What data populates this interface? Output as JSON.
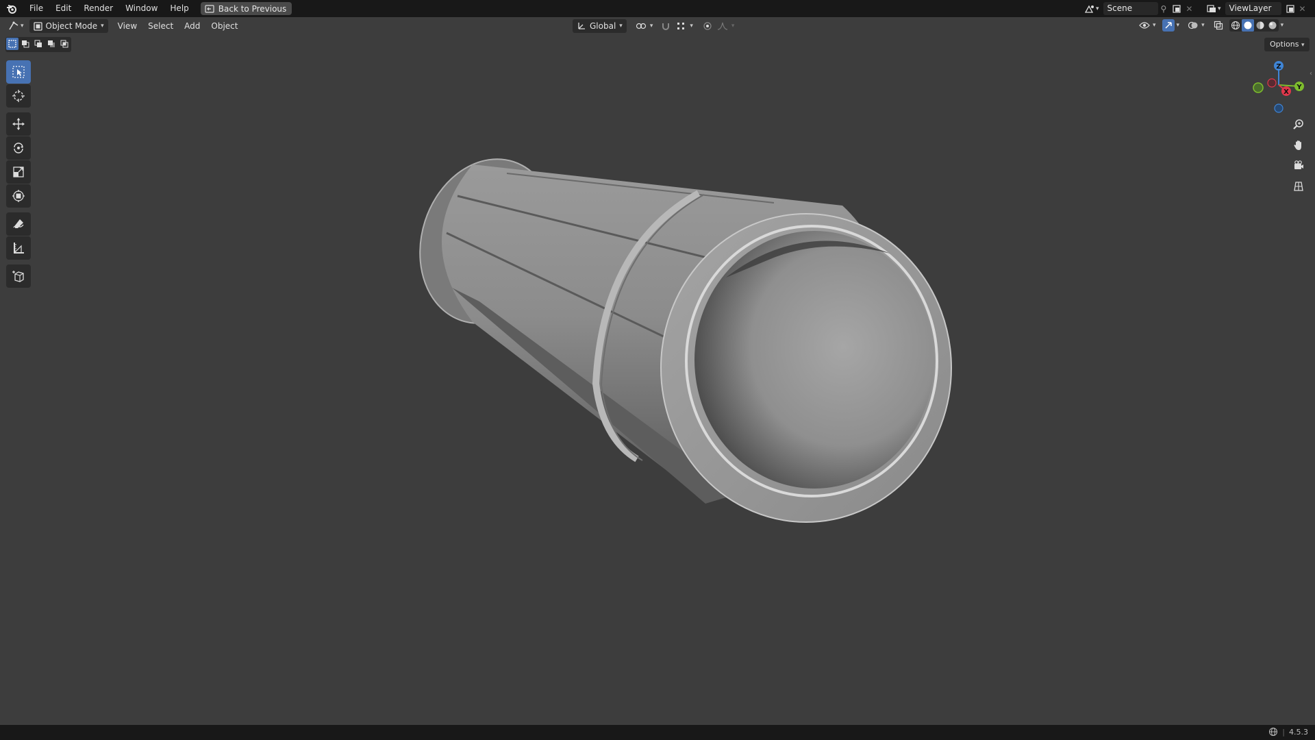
{
  "menu": {
    "items": [
      "File",
      "Edit",
      "Render",
      "Window",
      "Help"
    ],
    "back_button": "Back to Previous"
  },
  "scene": {
    "label": "Scene"
  },
  "view_layer": {
    "label": "ViewLayer"
  },
  "viewport_header": {
    "mode": "Object Mode",
    "menus": [
      "View",
      "Select",
      "Add",
      "Object"
    ],
    "transform_orientation": "Global",
    "options": "Options"
  },
  "gizmo": {
    "x": "X",
    "y": "Y",
    "z": "Z"
  },
  "status": {
    "version": "4.5.3"
  },
  "colors": {
    "accent": "#4772b3",
    "background": "#3d3d3d",
    "topbar": "#181818",
    "axis_x": "#e0374b",
    "axis_y": "#7ebd2d",
    "axis_z": "#3f85d6"
  },
  "tools": [
    "select-box-icon",
    "cursor-icon",
    "move-icon",
    "rotate-icon",
    "scale-icon",
    "transform-icon",
    "annotate-icon",
    "measure-icon",
    "add-cube-icon"
  ]
}
